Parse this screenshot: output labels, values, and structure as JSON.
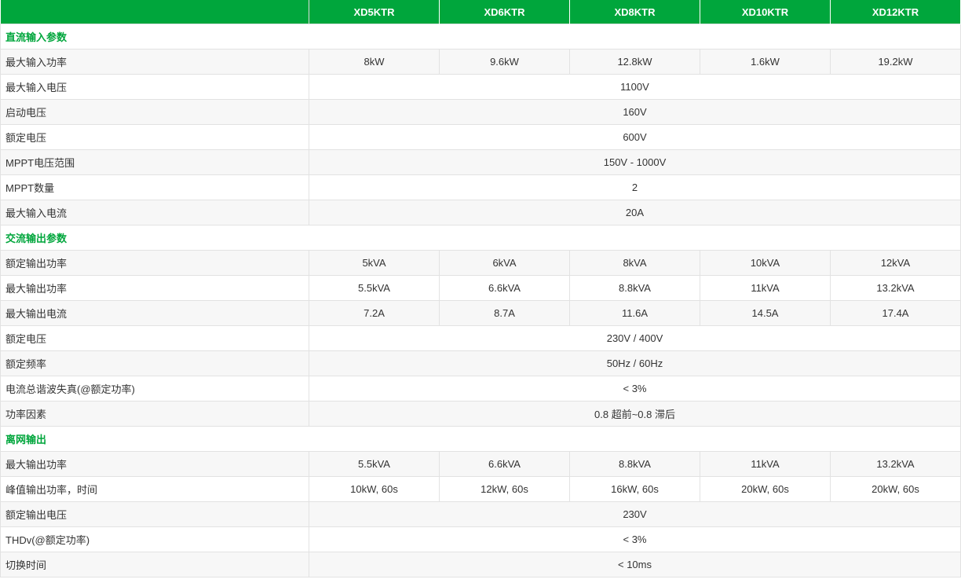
{
  "header": [
    "",
    "XD5KTR",
    "XD6KTR",
    "XD8KTR",
    "XD10KTR",
    "XD12KTR"
  ],
  "colors": {
    "accent": "#00a63c",
    "stripe": "#f7f7f7",
    "border": "#e2e2e2"
  },
  "rows": [
    {
      "type": "section",
      "label": "直流输入参数"
    },
    {
      "label": "最大输入功率",
      "values": [
        "8kW",
        "9.6kW",
        "12.8kW",
        "1.6kW",
        "19.2kW"
      ]
    },
    {
      "label": "最大输入电压",
      "value": "1100V"
    },
    {
      "label": "启动电压",
      "value": "160V"
    },
    {
      "label": "额定电压",
      "value": "600V"
    },
    {
      "label": "MPPT电压范围",
      "value": "150V - 1000V"
    },
    {
      "label": "MPPT数量",
      "value": "2"
    },
    {
      "label": "最大输入电流",
      "value": "20A"
    },
    {
      "type": "section",
      "label": "交流输出参数"
    },
    {
      "label": "额定输出功率",
      "values": [
        "5kVA",
        "6kVA",
        "8kVA",
        "10kVA",
        "12kVA"
      ]
    },
    {
      "label": "最大输出功率",
      "values": [
        "5.5kVA",
        "6.6kVA",
        "8.8kVA",
        "11kVA",
        "13.2kVA"
      ]
    },
    {
      "label": "最大输出电流",
      "values": [
        "7.2A",
        "8.7A",
        "11.6A",
        "14.5A",
        "17.4A"
      ]
    },
    {
      "label": "额定电压",
      "value": "230V / 400V"
    },
    {
      "label": "额定频率",
      "value": "50Hz / 60Hz"
    },
    {
      "label": "电流总谐波失真(@额定功率)",
      "value": "< 3%"
    },
    {
      "label": "功率因素",
      "value": "0.8 超前~0.8 滞后"
    },
    {
      "type": "section",
      "label": "离网输出"
    },
    {
      "label": "最大输出功率",
      "values": [
        "5.5kVA",
        "6.6kVA",
        "8.8kVA",
        "11kVA",
        "13.2kVA"
      ]
    },
    {
      "label": "峰值输出功率，时间",
      "values": [
        "10kW, 60s",
        "12kW, 60s",
        "16kW, 60s",
        "20kW, 60s",
        "20kW, 60s"
      ]
    },
    {
      "label": "额定输出电压",
      "value": "230V"
    },
    {
      "label": "THDv(@额定功率)",
      "value": "< 3%"
    },
    {
      "label": "切换时间",
      "value": "< 10ms"
    }
  ]
}
